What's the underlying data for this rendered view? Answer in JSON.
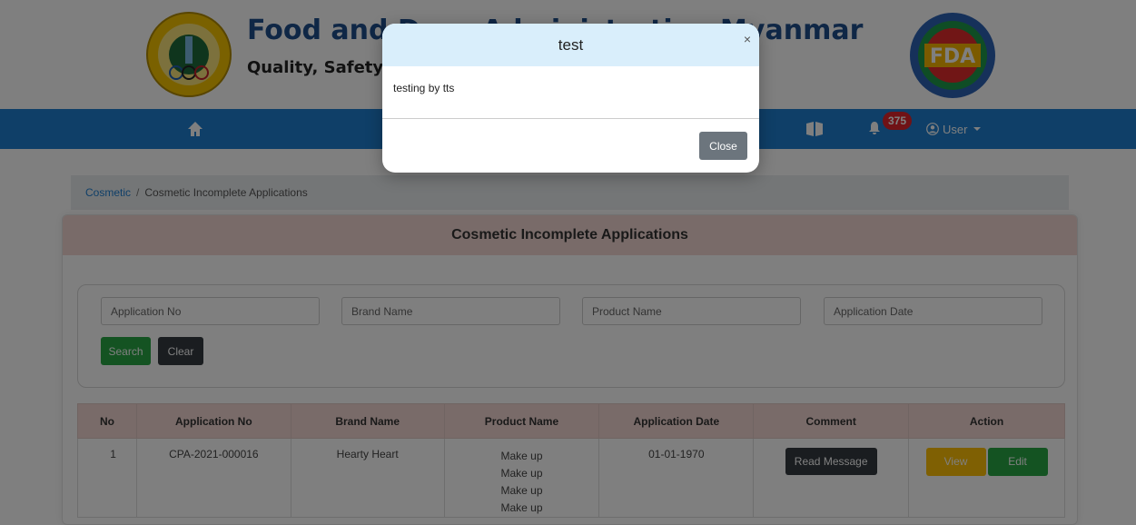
{
  "header": {
    "title": "Food and Drug Administration Myanmar",
    "subtitle": "Quality, Safety and Efficacy"
  },
  "navbar": {
    "notification_count": "375",
    "user_label": "User",
    "color": "#1e7fd1"
  },
  "breadcrumb": {
    "parent": "Cosmetic",
    "separator": "/",
    "current": "Cosmetic Incomplete Applications"
  },
  "card": {
    "title": "Cosmetic Incomplete Applications",
    "header_color": "#f2d7d3"
  },
  "search": {
    "application_no_placeholder": "Application No",
    "brand_name_placeholder": "Brand Name",
    "product_name_placeholder": "Product Name",
    "application_date_placeholder": "Application Date",
    "search_label": "Search",
    "clear_label": "Clear"
  },
  "table": {
    "columns": [
      "No",
      "Application No",
      "Brand Name",
      "Product Name",
      "Application Date",
      "Comment",
      "Action"
    ],
    "rows": [
      {
        "no": "1",
        "application_no": "CPA-2021-000016",
        "brand_name": "Hearty Heart",
        "product_names": [
          "Make up",
          "Make up",
          "Make up",
          "Make up"
        ],
        "application_date": "01-01-1970",
        "comment_button": "Read Message",
        "view_button": "View",
        "edit_button": "Edit"
      }
    ]
  },
  "modal": {
    "title": "test",
    "close_symbol": "×",
    "body": "testing by tts",
    "close_button": "Close"
  }
}
